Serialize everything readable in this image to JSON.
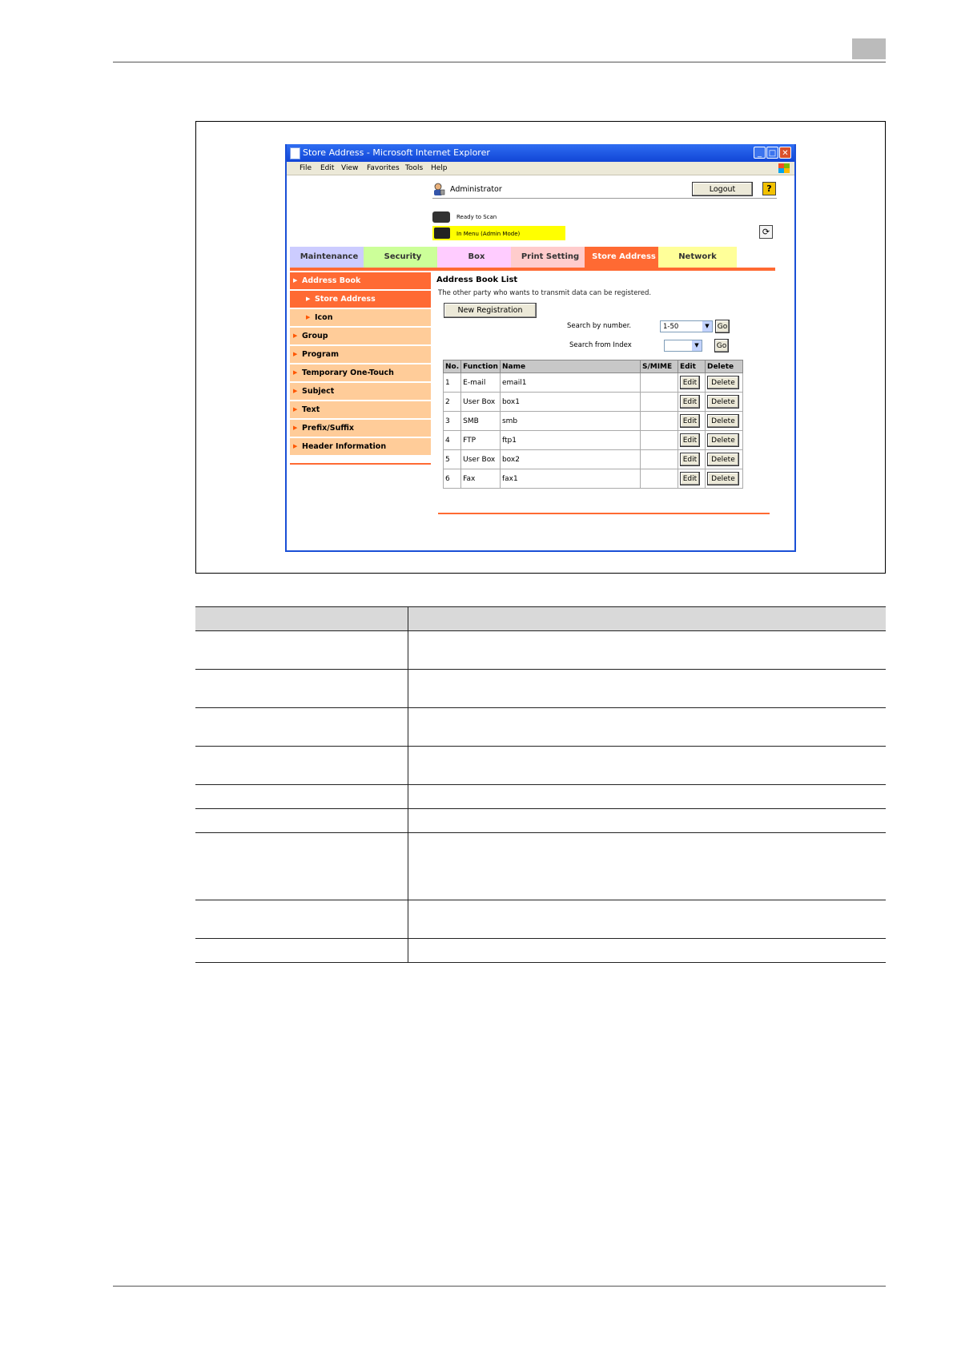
{
  "window": {
    "title": "Store Address - Microsoft Internet Explorer",
    "menu": [
      "File",
      "Edit",
      "View",
      "Favorites",
      "Tools",
      "Help"
    ]
  },
  "header": {
    "user": "Administrator",
    "logout_label": "Logout",
    "help_label": "?",
    "status_ready": "Ready to Scan",
    "status_mode": "In Menu (Admin Mode)"
  },
  "tabs": [
    {
      "label": "Maintenance",
      "color": "#ccccff"
    },
    {
      "label": "Security",
      "color": "#ccff99"
    },
    {
      "label": "Box",
      "color": "#ffccff"
    },
    {
      "label": "Print Setting",
      "color": "#ffcccc"
    },
    {
      "label": "Store Address",
      "color": "#ff6a33"
    },
    {
      "label": "Network",
      "color": "#ffff99"
    }
  ],
  "active_tab": "Store Address",
  "nav": [
    {
      "label": "Address Book",
      "level": 0,
      "active": true
    },
    {
      "label": "Store Address",
      "level": 1,
      "active": true
    },
    {
      "label": "Icon",
      "level": 1,
      "active": false
    },
    {
      "label": "Group",
      "level": 0,
      "active": false
    },
    {
      "label": "Program",
      "level": 0,
      "active": false
    },
    {
      "label": "Temporary One-Touch",
      "level": 0,
      "active": false
    },
    {
      "label": "Subject",
      "level": 0,
      "active": false
    },
    {
      "label": "Text",
      "level": 0,
      "active": false
    },
    {
      "label": "Prefix/Suffix",
      "level": 0,
      "active": false
    },
    {
      "label": "Header Information",
      "level": 0,
      "active": false
    }
  ],
  "main": {
    "title": "Address Book List",
    "description": "The other party who wants to transmit data can be registered.",
    "new_registration_label": "New Registration",
    "search_number_label": "Search by number.",
    "search_number_value": "1-50",
    "search_index_label": "Search from Index",
    "search_index_value": "",
    "go_label": "Go"
  },
  "table": {
    "columns": [
      "No.",
      "Function",
      "Name",
      "S/MIME",
      "Edit",
      "Delete"
    ],
    "edit_label": "Edit",
    "delete_label": "Delete",
    "rows": [
      {
        "no": "1",
        "function": "E-mail",
        "name": "email1",
        "smime": ""
      },
      {
        "no": "2",
        "function": "User Box",
        "name": "box1",
        "smime": ""
      },
      {
        "no": "3",
        "function": "SMB",
        "name": "smb",
        "smime": ""
      },
      {
        "no": "4",
        "function": "FTP",
        "name": "ftp1",
        "smime": ""
      },
      {
        "no": "5",
        "function": "User Box",
        "name": "box2",
        "smime": ""
      },
      {
        "no": "6",
        "function": "Fax",
        "name": "fax1",
        "smime": ""
      }
    ]
  }
}
